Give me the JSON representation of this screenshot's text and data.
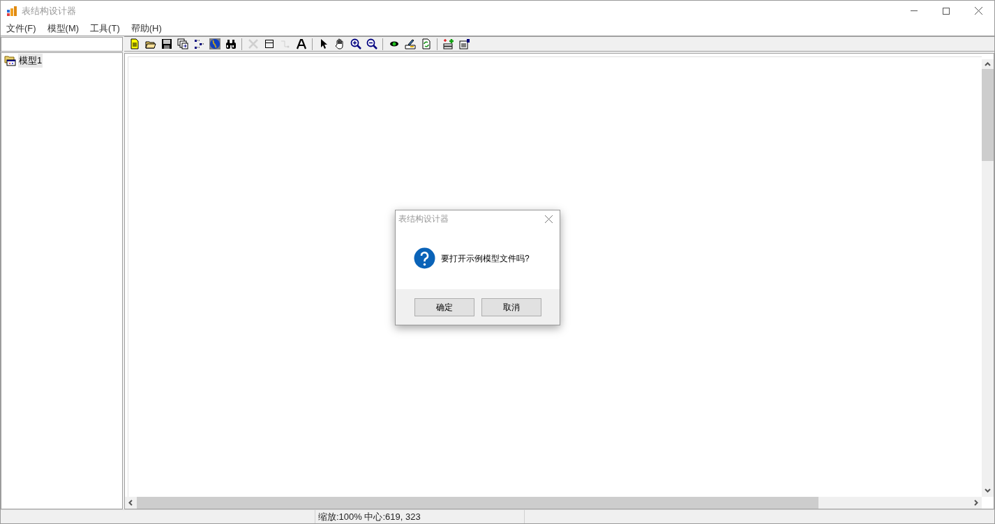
{
  "window": {
    "title": "表结构设计器"
  },
  "menu": [
    "文件(F)",
    "模型(M)",
    "工具(T)",
    "帮助(H)"
  ],
  "toolbar": [
    {
      "kind": "new",
      "disabled": false
    },
    {
      "kind": "open",
      "disabled": false
    },
    {
      "kind": "save",
      "disabled": false
    },
    {
      "kind": "copy",
      "disabled": false
    },
    {
      "kind": "tree",
      "disabled": false
    },
    {
      "kind": "globe",
      "disabled": false
    },
    {
      "kind": "find",
      "disabled": false
    },
    {
      "kind": "separator"
    },
    {
      "kind": "delete",
      "disabled": true
    },
    {
      "kind": "table",
      "disabled": false
    },
    {
      "kind": "connector",
      "disabled": true
    },
    {
      "kind": "text",
      "disabled": false
    },
    {
      "kind": "separator"
    },
    {
      "kind": "pointer",
      "disabled": false
    },
    {
      "kind": "hand",
      "disabled": false
    },
    {
      "kind": "zoomin",
      "disabled": false
    },
    {
      "kind": "zoomout",
      "disabled": false
    },
    {
      "kind": "separator"
    },
    {
      "kind": "eye",
      "disabled": false
    },
    {
      "kind": "edit",
      "disabled": false
    },
    {
      "kind": "refresh",
      "disabled": false
    },
    {
      "kind": "separator"
    },
    {
      "kind": "addfield",
      "disabled": false
    },
    {
      "kind": "properties",
      "disabled": false
    }
  ],
  "tree": {
    "items": [
      {
        "label": "模型1",
        "selected": true
      }
    ]
  },
  "dialog": {
    "title": "表结构设计器",
    "message": "要打开示例模型文件吗?",
    "buttons": [
      "确定",
      "取消"
    ]
  },
  "status_bar": {
    "text": "缩放:100% 中心:619, 323"
  }
}
